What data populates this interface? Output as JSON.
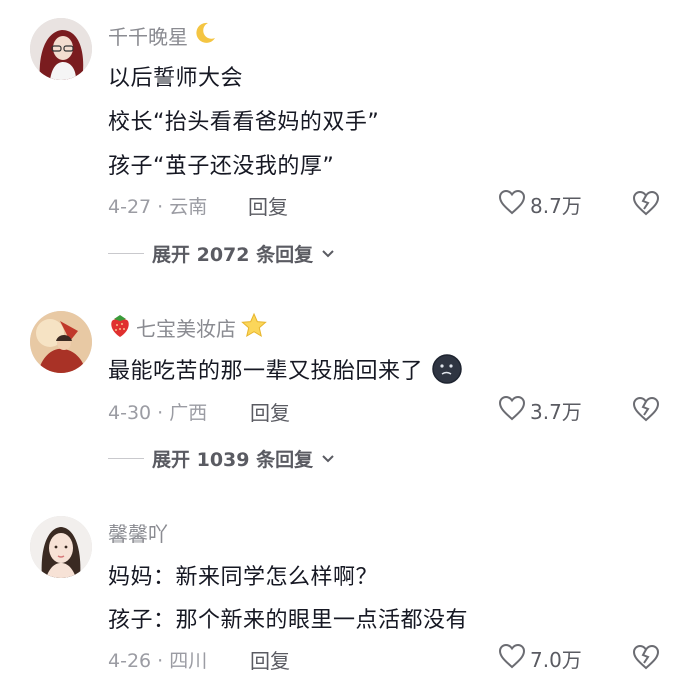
{
  "comments": [
    {
      "username": "千千晚星",
      "username_suffix_icon": "crescent-moon-icon",
      "lines": [
        "以后誓师大会",
        "校长“抬头看看爸妈的双手”",
        "孩子“茧子还没我的厚”"
      ],
      "date_location": "4-27 · 云南",
      "reply_label": "回复",
      "likes": "8.7万",
      "expand_label": "展开 2072 条回复"
    },
    {
      "username_prefix_icon": "strawberry-icon",
      "username": "七宝美妆店",
      "username_suffix_icon": "star-icon",
      "lines": [
        "最能吃苦的那一辈又投胎回来了"
      ],
      "line_suffix_icon": "dark-moon-face-icon",
      "date_location": "4-30 · 广西",
      "reply_label": "回复",
      "likes": "3.7万",
      "expand_label": "展开 1039 条回复"
    },
    {
      "username": "馨馨吖",
      "lines": [
        "妈妈：新来同学怎么样啊？",
        "孩子：那个新来的眼里一点活都没有"
      ],
      "date_location": "4-26 · 四川",
      "reply_label": "回复",
      "likes": "7.0万"
    }
  ],
  "colors": {
    "text_primary": "#161823",
    "text_secondary": "#8a8b91",
    "text_meta": "#9b9ca3",
    "action": "#5a5b62"
  }
}
